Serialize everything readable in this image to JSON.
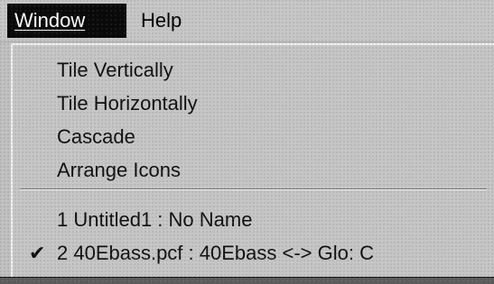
{
  "menubar": {
    "window_label": "Window",
    "help_label": "Help"
  },
  "menu": {
    "items": [
      {
        "label": "Tile Vertically",
        "checked": false
      },
      {
        "label": "Tile Horizontally",
        "checked": false
      },
      {
        "label": "Cascade",
        "checked": false
      },
      {
        "label": "Arrange Icons",
        "checked": false
      },
      {
        "label": "1 Untitled1 : No Name",
        "checked": false
      },
      {
        "label": "2 40Ebass.pcf : 40Ebass <-> Glo: C",
        "checked": true
      }
    ]
  },
  "check_symbol": "✔"
}
